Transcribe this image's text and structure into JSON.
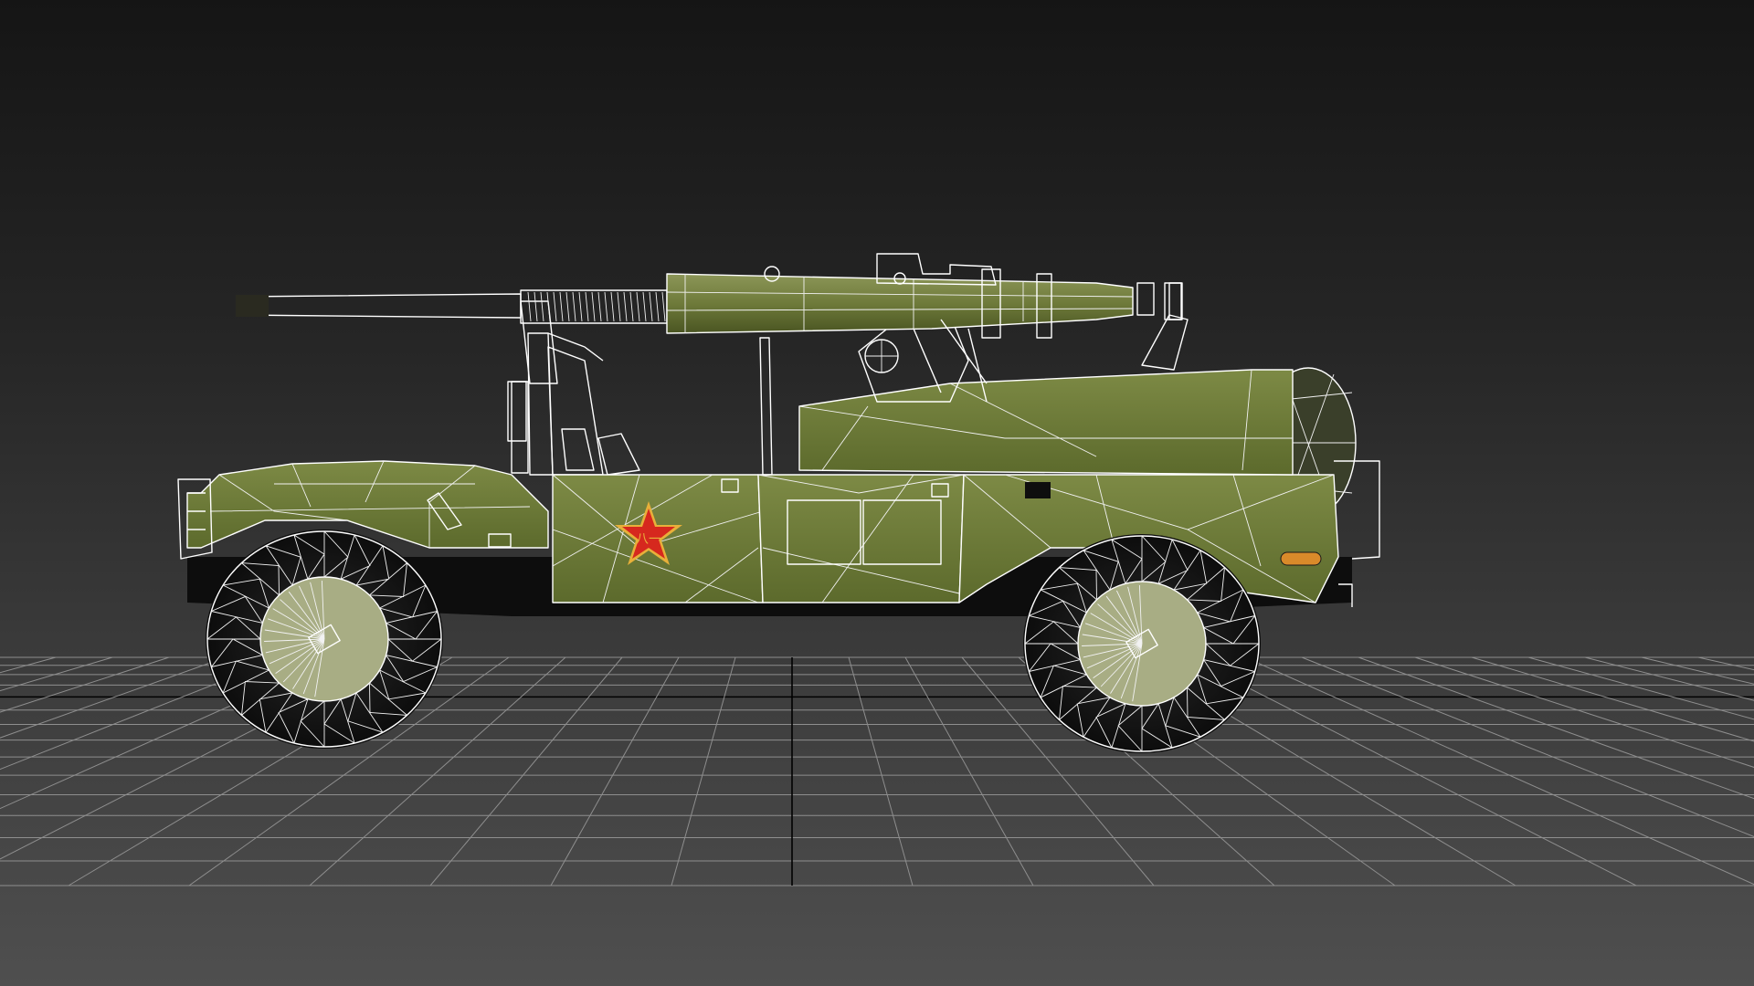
{
  "viewport": {
    "name": "3d-perspective-viewport",
    "background_top": "#151515",
    "background_bottom": "#4f4f4f",
    "grid_color": "#8e8e8e",
    "axis_color": "#000000"
  },
  "model": {
    "type": "military-utility-vehicle-with-recoilless-rifle",
    "display_mode": "textured-with-wireframe-overlay",
    "body_color": "#6f7d3d",
    "body_color_dark": "#4d5a24",
    "wire_color": "#ffffff",
    "insignia": {
      "icon": "star-insignia-icon",
      "star_color": "#d6281e",
      "outline_color": "#e8b03a",
      "glyph": "八一"
    },
    "side_marker_color": "#d98a2a"
  }
}
